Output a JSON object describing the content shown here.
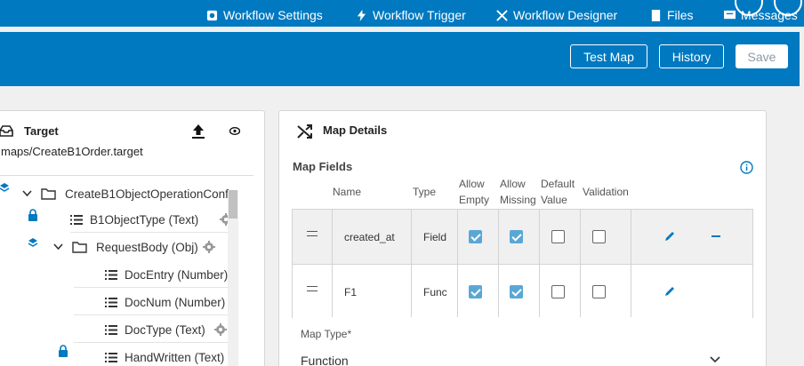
{
  "topnav": {
    "items": [
      {
        "label": "Workflow Settings",
        "icon": "gear-icon"
      },
      {
        "label": "Workflow Trigger",
        "icon": "lightning-icon"
      },
      {
        "label": "Workflow Designer",
        "icon": "flow-icon"
      },
      {
        "label": "Files",
        "icon": "file-icon"
      },
      {
        "label": "Messages",
        "icon": "message-icon"
      }
    ]
  },
  "header": {
    "test_map_label": "Test Map",
    "history_label": "History",
    "save_label": "Save"
  },
  "target": {
    "title": "Target",
    "path": "maps/CreateB1Order.target",
    "tree": [
      {
        "label": "CreateB1ObjectOperationConf",
        "kind": "folder",
        "expanded": true
      },
      {
        "label": "B1ObjectType (Text)",
        "kind": "field",
        "locked": true,
        "settings": true
      },
      {
        "label": "RequestBody (Obj)",
        "kind": "folder",
        "expanded": true,
        "layers": true,
        "settings": true
      },
      {
        "label": "DocEntry (Number)",
        "kind": "field"
      },
      {
        "label": "DocNum (Number)",
        "kind": "field"
      },
      {
        "label": "DocType (Text)",
        "kind": "field",
        "settings": true
      },
      {
        "label": "HandWritten (Text)",
        "kind": "field",
        "locked": true
      }
    ]
  },
  "details": {
    "title": "Map Details",
    "fields_title": "Map Fields",
    "columns": {
      "name": "Name",
      "type": "Type",
      "allow_empty_1": "Allow",
      "allow_empty_2": "Empty",
      "allow_missing_1": "Allow",
      "allow_missing_2": "Missing",
      "default_value_1": "Default",
      "default_value_2": "Value",
      "validation": "Validation"
    },
    "rows": [
      {
        "name": "created_at",
        "type": "Field",
        "allow_empty": true,
        "allow_missing": true,
        "default_value": false,
        "validation": false,
        "removable": true
      },
      {
        "name": "F1",
        "type": "Func",
        "allow_empty": true,
        "allow_missing": true,
        "default_value": false,
        "validation": false,
        "removable": false
      }
    ],
    "map_type_label": "Map Type*",
    "map_type_value": "Function"
  },
  "colors": {
    "brand": "#0079c1",
    "checked": "#5aa7d6"
  }
}
